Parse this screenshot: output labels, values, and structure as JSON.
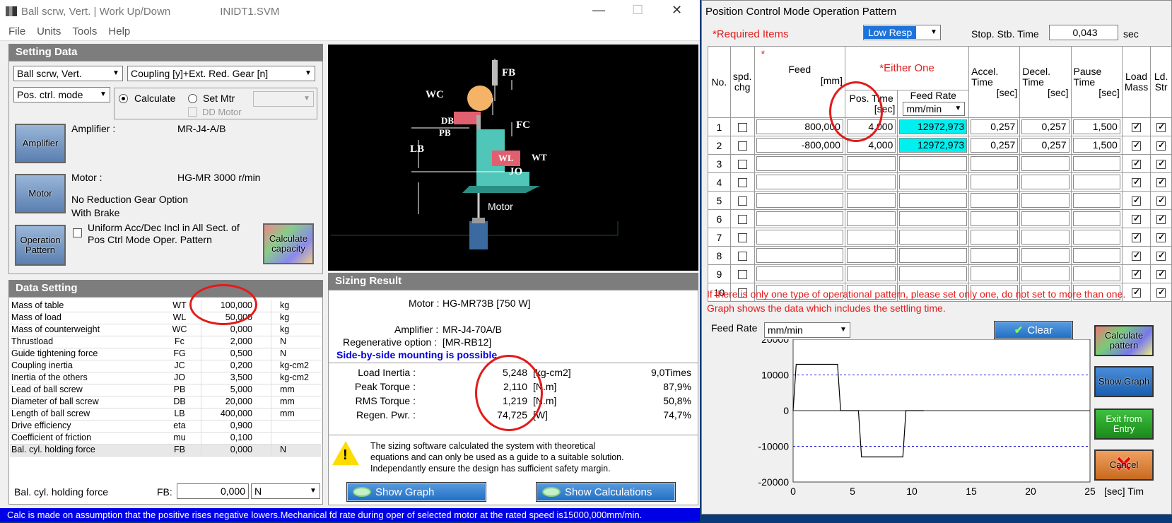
{
  "win1": {
    "title": "Ball scrw, Vert.  | Work Up/Down",
    "filename": "INIDT1.SVM",
    "menu": [
      "File",
      "Units",
      "Tools",
      "Help"
    ]
  },
  "setting": {
    "header": "Setting Data",
    "drive_select": "Ball scrw, Vert.",
    "coupling_select": "Coupling [y]+Ext. Red. Gear [n]",
    "mode_select": "Pos. ctrl. mode",
    "radio_calculate": "Calculate",
    "radio_setmtr": "Set Mtr",
    "dd_motor": "DD Motor",
    "amp_btn": "Amplifier",
    "amp_label": "Amplifier :",
    "amp_value": "MR-J4-A/B",
    "motor_btn": "Motor",
    "motor_label": "Motor :",
    "motor_value": "HG-MR   3000 r/min",
    "gear_text": "No Reduction Gear Option",
    "brake_text": "With Brake",
    "op_btn": "Operation Pattern",
    "uniform_line1": "Uniform Acc/Dec Incl in All Sect. of",
    "uniform_line2": "Pos Ctrl Mode Oper. Pattern",
    "calc_btn": "Calculate capacity"
  },
  "diagram": {
    "fb": "FB",
    "wc": "WC",
    "db": "DB",
    "pb": "PB",
    "fc": "FC",
    "lb": "LB",
    "wl": "WL",
    "wt": "WT",
    "jo": "JO",
    "motor": "Motor"
  },
  "data_setting": {
    "header": "Data Setting",
    "rows": [
      {
        "name": "Mass of table",
        "sym": "WT",
        "val": "100,000",
        "unit": "kg"
      },
      {
        "name": "Mass of load",
        "sym": "WL",
        "val": "50,000",
        "unit": "kg"
      },
      {
        "name": "Mass of counterweight",
        "sym": "WC",
        "val": "0,000",
        "unit": "kg"
      },
      {
        "name": "Thrustload",
        "sym": "Fc",
        "val": "2,000",
        "unit": "N"
      },
      {
        "name": "Guide tightening force",
        "sym": "FG",
        "val": "0,500",
        "unit": "N"
      },
      {
        "name": "Coupling inertia",
        "sym": "JC",
        "val": "0,200",
        "unit": "kg-cm2"
      },
      {
        "name": "Inertia of the others",
        "sym": "JO",
        "val": "3,500",
        "unit": "kg-cm2"
      },
      {
        "name": "Lead of ball screw",
        "sym": "PB",
        "val": "5,000",
        "unit": "mm"
      },
      {
        "name": "Diameter of ball screw",
        "sym": "DB",
        "val": "20,000",
        "unit": "mm"
      },
      {
        "name": "Length of ball screw",
        "sym": "LB",
        "val": "400,000",
        "unit": "mm"
      },
      {
        "name": "Drive efficiency",
        "sym": "eta",
        "val": "0,900",
        "unit": ""
      },
      {
        "name": "Coefficient of friction",
        "sym": "mu",
        "val": "0,100",
        "unit": ""
      },
      {
        "name": "Bal. cyl. holding force",
        "sym": "FB",
        "val": "0,000",
        "unit": "N"
      }
    ],
    "bottom_label": "Bal. cyl. holding force",
    "bottom_sym": "FB:",
    "bottom_val": "0,000",
    "bottom_unit": "N"
  },
  "sizing": {
    "header": "Sizing Result",
    "motor_label": "Motor :",
    "motor_value": "HG-MR73B [750 W]",
    "amp_label": "Amplifier :",
    "amp_value": "MR-J4-70A/B",
    "regen_label": "Regenerative option :",
    "regen_value": "[MR-RB12]",
    "side_note": "Side-by-side mounting is possible.",
    "results": [
      {
        "name": "Load Inertia :",
        "val": "5,248",
        "unit": "[kg-cm2]",
        "ratio": "9,0Times"
      },
      {
        "name": "Peak Torque :",
        "val": "2,110",
        "unit": "[N.m]",
        "ratio": "87,9%"
      },
      {
        "name": "RMS Torque :",
        "val": "1,219",
        "unit": "[N.m]",
        "ratio": "50,8%"
      },
      {
        "name": "Regen. Pwr. :",
        "val": "74,725",
        "unit": "[W]",
        "ratio": "74,7%"
      }
    ],
    "warn1": "The sizing software calculated the system with theoretical",
    "warn2": "equations and can only be used as a guide to a suitable solution.",
    "warn3": "Independantly ensure the design has sufficient safety margin.",
    "show_graph": "Show Graph",
    "show_calc": "Show Calculations"
  },
  "status": "Calc is made on assumption that the positive rises negative lowers.Mechanical fd rate during oper of selected motor at the rated speed is15000,000mm/min.",
  "win2": {
    "title": "Position Control Mode Operation Pattern",
    "required": "*Required Items",
    "resp": "Low  Resp",
    "stop_label": "Stop. Stb. Time",
    "stop_value": "0,043",
    "stop_unit": "sec",
    "headers": {
      "no": "No.",
      "spd": "spd.",
      "chg": "chg",
      "star": "*",
      "feed": "Feed",
      "feed_unit": "[mm]",
      "either": "*Either One",
      "pos_time": "Pos. Time",
      "pos_unit": "[sec]",
      "feed_rate": "Feed Rate",
      "fr_unit": "mm/min",
      "accel": "Accel.",
      "accel2": "Time",
      "accel_unit": "[sec]",
      "decel": "Decel.",
      "decel2": "Time",
      "decel_unit": "[sec]",
      "pause": "Pause",
      "pause2": "Time",
      "pause_unit": "[sec]",
      "load": "Load",
      "load2": "Mass",
      "ld": "Ld.",
      "ld2": "Str"
    },
    "rows": [
      {
        "no": "1",
        "feed": "800,000",
        "pos": "4,000",
        "rate": "12972,973",
        "acc": "0,257",
        "dec": "0,257",
        "pause": "1,500"
      },
      {
        "no": "2",
        "feed": "-800,000",
        "pos": "4,000",
        "rate": "12972,973",
        "acc": "0,257",
        "dec": "0,257",
        "pause": "1,500"
      },
      {
        "no": "3",
        "feed": "",
        "pos": "",
        "rate": "",
        "acc": "",
        "dec": "",
        "pause": ""
      },
      {
        "no": "4",
        "feed": "",
        "pos": "",
        "rate": "",
        "acc": "",
        "dec": "",
        "pause": ""
      },
      {
        "no": "5",
        "feed": "",
        "pos": "",
        "rate": "",
        "acc": "",
        "dec": "",
        "pause": ""
      },
      {
        "no": "6",
        "feed": "",
        "pos": "",
        "rate": "",
        "acc": "",
        "dec": "",
        "pause": ""
      },
      {
        "no": "7",
        "feed": "",
        "pos": "",
        "rate": "",
        "acc": "",
        "dec": "",
        "pause": ""
      },
      {
        "no": "8",
        "feed": "",
        "pos": "",
        "rate": "",
        "acc": "",
        "dec": "",
        "pause": ""
      },
      {
        "no": "9",
        "feed": "",
        "pos": "",
        "rate": "",
        "acc": "",
        "dec": "",
        "pause": ""
      },
      {
        "no": "10",
        "feed": "",
        "pos": "",
        "rate": "",
        "acc": "",
        "dec": "",
        "pause": ""
      }
    ],
    "warn_line1": "If there is only one type of operational pattern, please set only one, do not set to more than one.",
    "warn_line2": "Graph shows the data which includes the settling time.",
    "graph_fr_label": "Feed Rate",
    "graph_fr_unit": "mm/min",
    "clear": "Clear",
    "calc_pattern": "Calculate pattern",
    "show_graph": "Show Graph",
    "exit_entry": "Exit from Entry",
    "cancel": "Cancel"
  },
  "chart_data": {
    "type": "line",
    "xlabel": "[sec] Time",
    "xlim": [
      0,
      25
    ],
    "ylim": [
      -20000,
      20000
    ],
    "xticks": [
      "0",
      "5",
      "10",
      "15",
      "20",
      "25"
    ],
    "yticks": [
      "20000",
      "10000",
      "0",
      "-10000",
      "-20000"
    ],
    "series": [
      {
        "x": [
          0,
          0.26,
          3.74,
          4.0,
          5.5,
          5.76,
          9.24,
          9.5,
          11.0
        ],
        "y": [
          0,
          12973,
          12973,
          0,
          0,
          -12973,
          -12973,
          0,
          0
        ]
      }
    ]
  }
}
